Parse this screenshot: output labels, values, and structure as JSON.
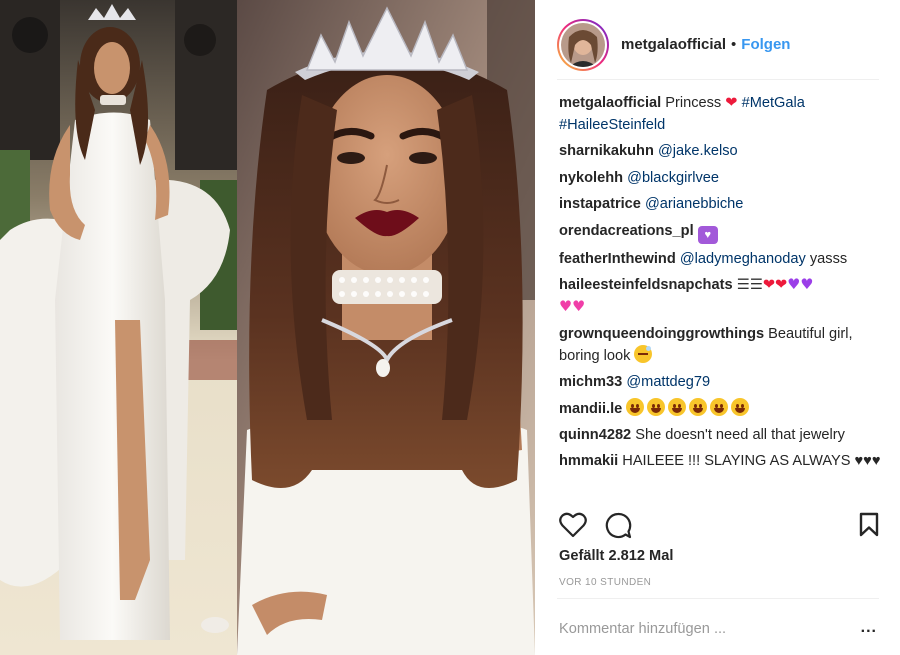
{
  "header": {
    "username": "metgalaofficial",
    "separator": "•",
    "follow_label": "Folgen",
    "avatar_icon": "profile-avatar"
  },
  "caption": {
    "username": "metgalaofficial",
    "text": "Princess",
    "emoji": "❤️",
    "hashtags": [
      "#MetGala",
      "#HaileeSteinfeld"
    ]
  },
  "comments": [
    {
      "user": "sharnikakuhn",
      "link": "@jake.kelso"
    },
    {
      "user": "nykolehh",
      "link": "@blackgirlvee"
    },
    {
      "user": "instapatrice",
      "link": "@arianebbiche"
    },
    {
      "user": "orendacreations_pl",
      "emoji": "sparkling-heart-icon"
    },
    {
      "user": "featherInthewind",
      "link": "@ladymeghanoday",
      "text": "yasss"
    },
    {
      "user": "haileesteinfeldsnapchats",
      "emoji": "hearts-icon"
    },
    {
      "user": "grownqueendoinggrowthings",
      "text": "Beautiful girl, boring look",
      "emoji": "sleepy-face-icon"
    },
    {
      "user": "michm33",
      "link": "@mattdeg79"
    },
    {
      "user": "mandii.le",
      "emoji": "heart-eyes-icon"
    },
    {
      "user": "quinn4282",
      "text": "She doesn't need all that jewelry"
    },
    {
      "user": "hmmakii",
      "text": "HAILEEE !!! SLAYING AS ALWAYS ♥♥♥"
    }
  ],
  "actions": {
    "like_icon": "heart-outline-icon",
    "comment_icon": "speech-bubble-icon",
    "save_icon": "bookmark-icon"
  },
  "likes_text": "Gefällt 2.812 Mal",
  "timestamp": "VOR 10 STUNDEN",
  "comment_box": {
    "placeholder": "Kommentar hinzufügen ...",
    "more_label": "..."
  },
  "colors": {
    "accent_blue": "#3897f0",
    "link_blue": "#003569",
    "text": "#262626",
    "muted": "#999999",
    "heart_red": "#ed1a3b",
    "divider": "#efefef"
  }
}
